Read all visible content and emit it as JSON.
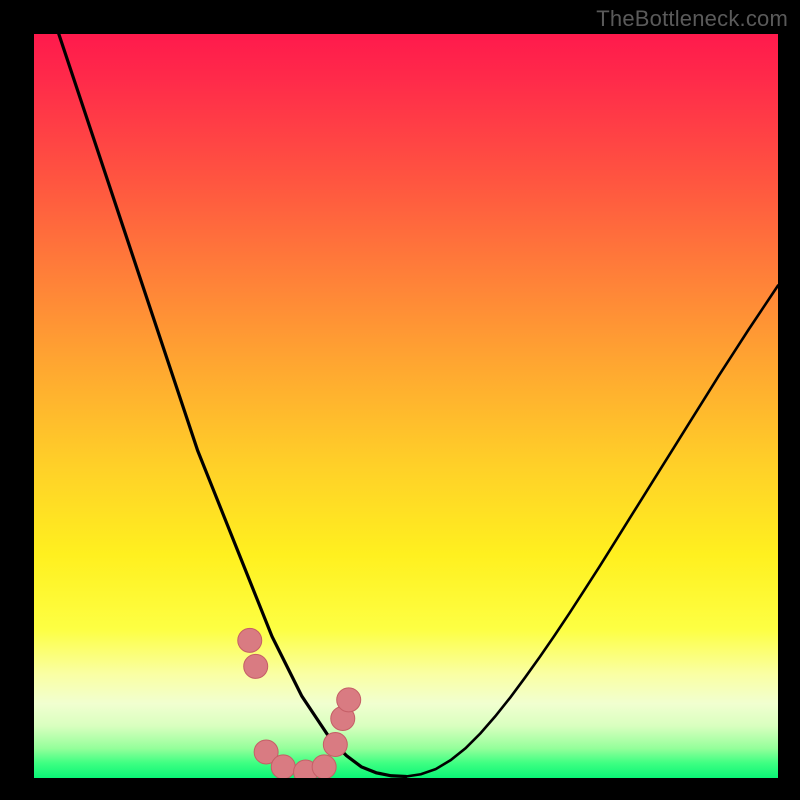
{
  "watermark": "TheBottleneck.com",
  "colors": {
    "frame": "#000000",
    "curve": "#000000",
    "marker_fill": "#d97b82",
    "marker_stroke": "#c55e66",
    "gradient_stops": [
      "#ff1a4c",
      "#ff2a4a",
      "#ff5640",
      "#ff7e39",
      "#ffa531",
      "#ffd028",
      "#fff01f",
      "#fdff43",
      "#faffa3",
      "#f1ffd0",
      "#d9ffbf",
      "#95ff9b",
      "#3eff82",
      "#0af576"
    ]
  },
  "chart_data": {
    "type": "line",
    "title": "",
    "xlabel": "",
    "ylabel": "",
    "ylim": [
      0,
      100
    ],
    "xlim": [
      0,
      100
    ],
    "x": [
      0,
      2,
      4,
      6,
      8,
      10,
      12,
      14,
      16,
      18,
      20,
      22,
      24,
      26,
      28,
      30,
      32,
      34,
      36,
      38,
      40,
      42,
      44,
      46,
      48,
      50,
      52,
      54,
      56,
      58,
      60,
      62,
      64,
      66,
      68,
      70,
      72,
      74,
      76,
      78,
      80,
      82,
      84,
      86,
      88,
      90,
      92,
      94,
      96,
      98,
      100
    ],
    "series": [
      {
        "name": "curve",
        "values": [
          110,
          104,
          98,
          92,
          86,
          80,
          74,
          68,
          62,
          56,
          50,
          44,
          39,
          34,
          29,
          24,
          19,
          15,
          11,
          8,
          5,
          3,
          1.5,
          0.7,
          0.3,
          0.2,
          0.5,
          1.2,
          2.4,
          4,
          6,
          8.3,
          10.8,
          13.5,
          16.3,
          19.2,
          22.2,
          25.3,
          28.4,
          31.6,
          34.8,
          38,
          41.2,
          44.4,
          47.6,
          50.8,
          54,
          57.1,
          60.2,
          63.2,
          66.2
        ]
      }
    ],
    "markers": [
      {
        "x": 29.0,
        "y": 18.5
      },
      {
        "x": 29.8,
        "y": 15.0
      },
      {
        "x": 31.2,
        "y": 3.5
      },
      {
        "x": 33.5,
        "y": 1.5
      },
      {
        "x": 36.5,
        "y": 0.8
      },
      {
        "x": 39.0,
        "y": 1.5
      },
      {
        "x": 40.5,
        "y": 4.5
      },
      {
        "x": 41.5,
        "y": 8.0
      },
      {
        "x": 42.3,
        "y": 10.5
      }
    ]
  }
}
